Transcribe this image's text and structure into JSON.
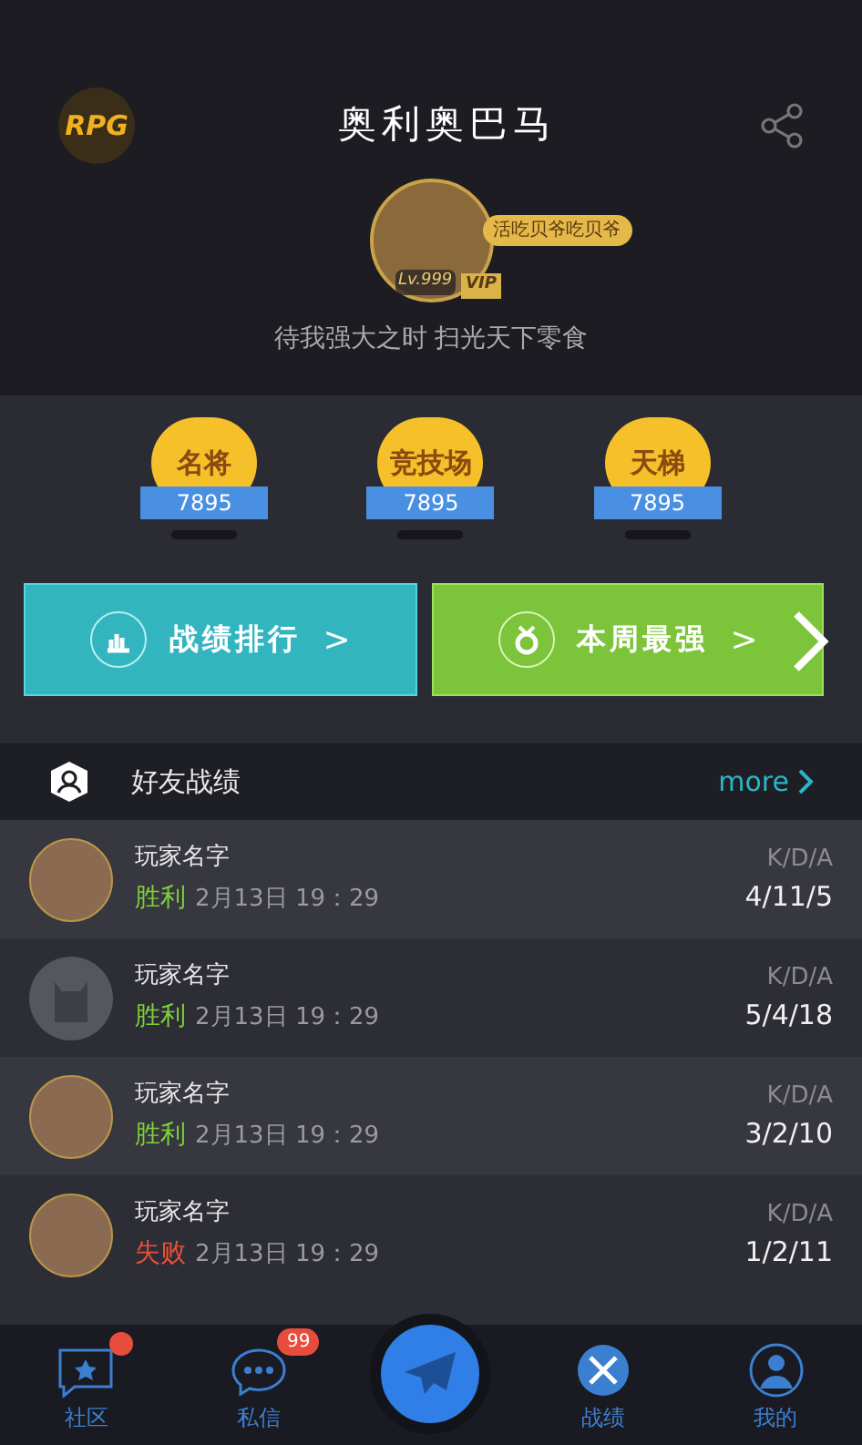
{
  "header": {
    "logo": "RPG",
    "title": "奥利奥巴马"
  },
  "profile": {
    "tag": "活吃贝爷吃贝爷",
    "level": "Lv.999",
    "vip": "VIP",
    "motto": "待我强大之时 扫光天下零食"
  },
  "ranks": [
    {
      "label": "名将",
      "score": "7895"
    },
    {
      "label": "竞技场",
      "score": "7895"
    },
    {
      "label": "天梯",
      "score": "7895"
    }
  ],
  "actions": [
    {
      "kind": "chart",
      "label": "战绩排行",
      "arrow": ">"
    },
    {
      "kind": "medal",
      "label": "本周最强",
      "arrow": ">"
    }
  ],
  "friends": {
    "title": "好友战绩",
    "more": "more",
    "rows": [
      {
        "kind": "photo",
        "name": "玩家名字",
        "result": "胜利",
        "win": true,
        "time": "2月13日 19：29",
        "kda_label": "K/D/A",
        "kda": "4/11/5"
      },
      {
        "kind": "default",
        "name": "玩家名字",
        "result": "胜利",
        "win": true,
        "time": "2月13日 19：29",
        "kda_label": "K/D/A",
        "kda": "5/4/18"
      },
      {
        "kind": "photo",
        "name": "玩家名字",
        "result": "胜利",
        "win": true,
        "time": "2月13日 19：29",
        "kda_label": "K/D/A",
        "kda": "3/2/10"
      },
      {
        "kind": "photo",
        "name": "玩家名字",
        "result": "失败",
        "win": false,
        "time": "2月13日 19：29",
        "kda_label": "K/D/A",
        "kda": "1/2/11"
      }
    ]
  },
  "nav": [
    {
      "kind": "community",
      "label": "社区",
      "dot": true
    },
    {
      "kind": "messages",
      "label": "私信",
      "badge": "99"
    },
    {
      "kind": "send"
    },
    {
      "kind": "records",
      "label": "战绩"
    },
    {
      "kind": "me",
      "label": "我的"
    }
  ]
}
